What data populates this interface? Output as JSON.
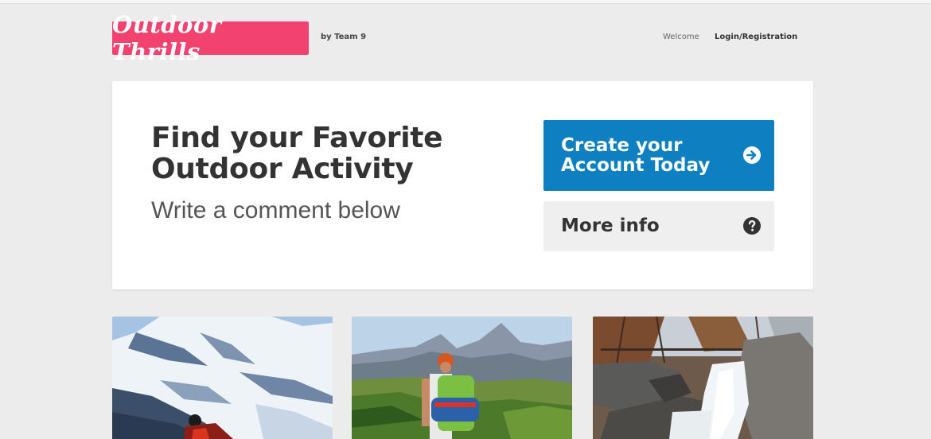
{
  "header": {
    "logo_text": "Outdoor Thrills",
    "byline": "by Team 9",
    "nav": {
      "welcome_label": "Welcome",
      "login_label": "Login/Registration"
    }
  },
  "hero": {
    "title": "Find your Favorite Outdoor Activity",
    "subtitle": "Write a comment below",
    "create_button": {
      "label": "Create your Account Today",
      "icon": "arrow-right-circle-icon"
    },
    "more_button": {
      "label": "More info",
      "icon": "question-circle-icon"
    }
  },
  "cards": [
    {
      "image": "snowy-mountain-climber-photo"
    },
    {
      "image": "hiker-with-backpack-mountains-photo"
    },
    {
      "image": "waterfall-rocks-forest-photo"
    }
  ],
  "colors": {
    "brand": "#f2426f",
    "primary_button": "#0e7fc1",
    "secondary_button": "#efefef",
    "background": "#ececec"
  }
}
